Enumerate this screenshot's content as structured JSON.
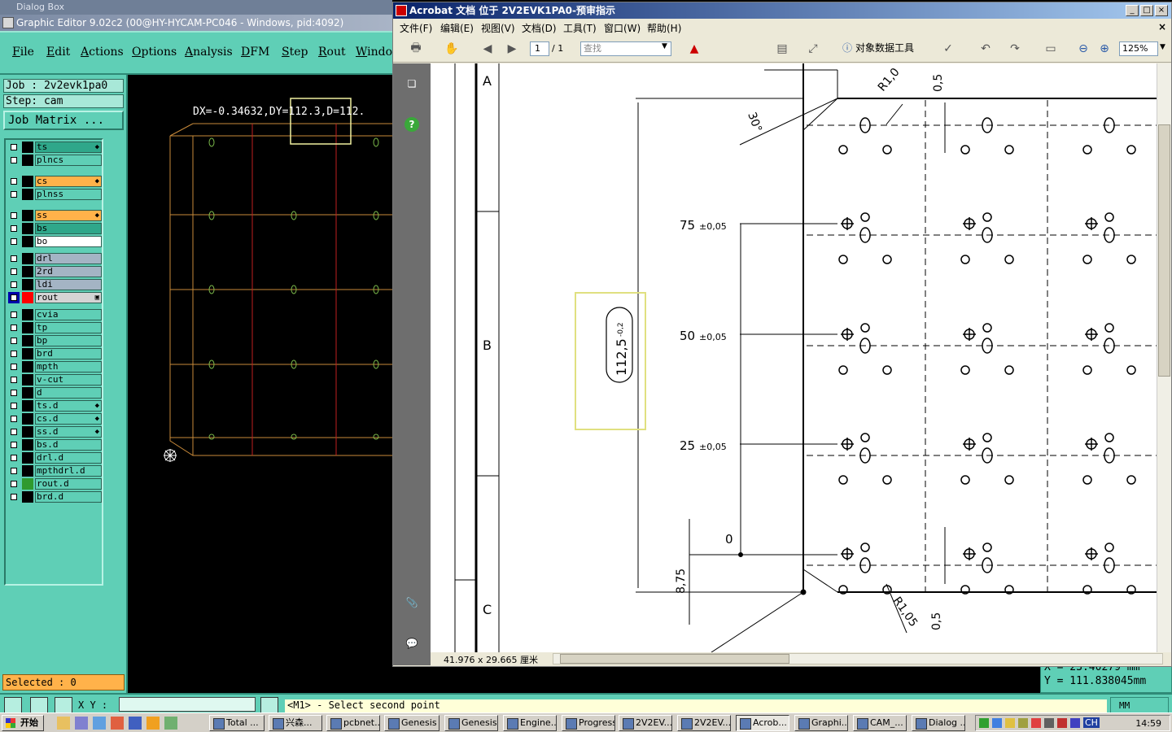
{
  "genesis": {
    "dialog_strip": "Dialog Box",
    "window_title": "Graphic Editor 9.02c2 (00@HY-HYCAM-PC046 - Windows, pid:4092)",
    "menu": [
      "File",
      "Edit",
      "Actions",
      "Options",
      "Analysis",
      "DFM",
      "Step",
      "Rout",
      "Window"
    ],
    "job_line": "Job : 2v2evk1pa0",
    "step_line": "Step: cam",
    "job_matrix_label": "Job Matrix ...",
    "layers": [
      {
        "name": "ts",
        "bg": "#2fa78a",
        "color": "#000000",
        "mark": "◆"
      },
      {
        "name": "plncs",
        "bg": "#5fcfb6",
        "color": "#000000",
        "mark": ""
      },
      {
        "name": "cs",
        "bg": "#ffb24a",
        "color": "#000000",
        "mark": "◆"
      },
      {
        "name": "plnss",
        "bg": "#5fcfb6",
        "color": "#000000",
        "mark": ""
      },
      {
        "name": "ss",
        "bg": "#ffb24a",
        "color": "#000000",
        "mark": "◆"
      },
      {
        "name": "bs",
        "bg": "#2fa78a",
        "color": "#000000",
        "mark": ""
      },
      {
        "name": "bo",
        "bg": "#ffffff",
        "color": "#000000",
        "mark": ""
      },
      {
        "name": "drl",
        "bg": "#a4b4c4",
        "color": "#000000",
        "mark": ""
      },
      {
        "name": "2rd",
        "bg": "#a4b4c4",
        "color": "#000000",
        "mark": ""
      },
      {
        "name": "ldi",
        "bg": "#a4b4c4",
        "color": "#000000",
        "mark": ""
      },
      {
        "name": "rout",
        "bg": "#d4d4d4",
        "color": "#ff0000",
        "mark": "▣",
        "cb_color": "#0000aa"
      },
      {
        "name": "cvia",
        "bg": "#5fcfb6",
        "color": "#000000",
        "mark": ""
      },
      {
        "name": "tp",
        "bg": "#5fcfb6",
        "color": "#000000",
        "mark": ""
      },
      {
        "name": "bp",
        "bg": "#5fcfb6",
        "color": "#000000",
        "mark": ""
      },
      {
        "name": "brd",
        "bg": "#5fcfb6",
        "color": "#000000",
        "mark": ""
      },
      {
        "name": "mpth",
        "bg": "#5fcfb6",
        "color": "#000000",
        "mark": ""
      },
      {
        "name": "v-cut",
        "bg": "#5fcfb6",
        "color": "#000000",
        "mark": ""
      },
      {
        "name": "d",
        "bg": "#5fcfb6",
        "color": "#000000",
        "mark": ""
      },
      {
        "name": "ts.d",
        "bg": "#5fcfb6",
        "color": "#000000",
        "mark": "◆"
      },
      {
        "name": "cs.d",
        "bg": "#5fcfb6",
        "color": "#000000",
        "mark": "◆"
      },
      {
        "name": "ss.d",
        "bg": "#5fcfb6",
        "color": "#000000",
        "mark": "◆"
      },
      {
        "name": "bs.d",
        "bg": "#5fcfb6",
        "color": "#000000",
        "mark": ""
      },
      {
        "name": "drl.d",
        "bg": "#5fcfb6",
        "color": "#000000",
        "mark": ""
      },
      {
        "name": "mpthdrl.d",
        "bg": "#5fcfb6",
        "color": "#000000",
        "mark": ""
      },
      {
        "name": "rout.d",
        "bg": "#5fcfb6",
        "color": "#2f9a2f",
        "mark": ""
      },
      {
        "name": "brd.d",
        "bg": "#5fcfb6",
        "color": "#000000",
        "mark": ""
      }
    ],
    "selected_label": "Selected : 0",
    "measure_readout": "DX=-0.34632,DY=112.3,D=112.",
    "xy_label": "X Y :",
    "xy_value": "",
    "prompt": "<M1> - Select second point",
    "units": "MM",
    "coord_x": "X = 23.40279 mm",
    "coord_y": "Y = 111.838045mm"
  },
  "acrobat": {
    "window_title": "Acrobat 文档 位于 2V2EVK1PA0-预审指示",
    "menu": [
      "文件(F)",
      "编辑(E)",
      "视图(V)",
      "文档(D)",
      "工具(T)",
      "窗口(W)",
      "帮助(H)"
    ],
    "page_current": "1",
    "page_total": "/ 1",
    "find_placeholder": "查找",
    "object_tool_label": "对象数据工具",
    "zoom": "125%",
    "page_size": "41.976 x 29.665 厘米",
    "drawing": {
      "zone_a": "A",
      "zone_b": "B",
      "zone_c": "C",
      "dim_75": "75",
      "dim_50": "50",
      "dim_25": "25",
      "dim_0": "0",
      "tol": "±0,05",
      "dim_875": "8,75",
      "angle": "30°",
      "radius_top": "R1,0",
      "radius_bottom": "R1,05",
      "dim_05": "0,5",
      "board_dim": "112,5",
      "board_tol": "-0,2"
    }
  },
  "taskbar": {
    "start": "开始",
    "tasks": [
      "Total ...",
      "兴森...",
      "pcbnet...",
      "Genesis",
      "Genesis",
      "Engine...",
      "Progress",
      "2V2EV...",
      "2V2EV...",
      "Acrob...",
      "Graphi...",
      "CAM_...",
      "Dialog ..."
    ],
    "clock": "14:59",
    "ime": "CH"
  },
  "colors": {
    "genesis_panel": "#5fcfb6",
    "canvas_bg": "#000000",
    "board_outline": "#c88a3a",
    "pad_green": "#7ab84a",
    "rout_red": "#c02020",
    "highlight_yellow": "#f0f0a0",
    "acrobat_title": "#0a246a"
  }
}
